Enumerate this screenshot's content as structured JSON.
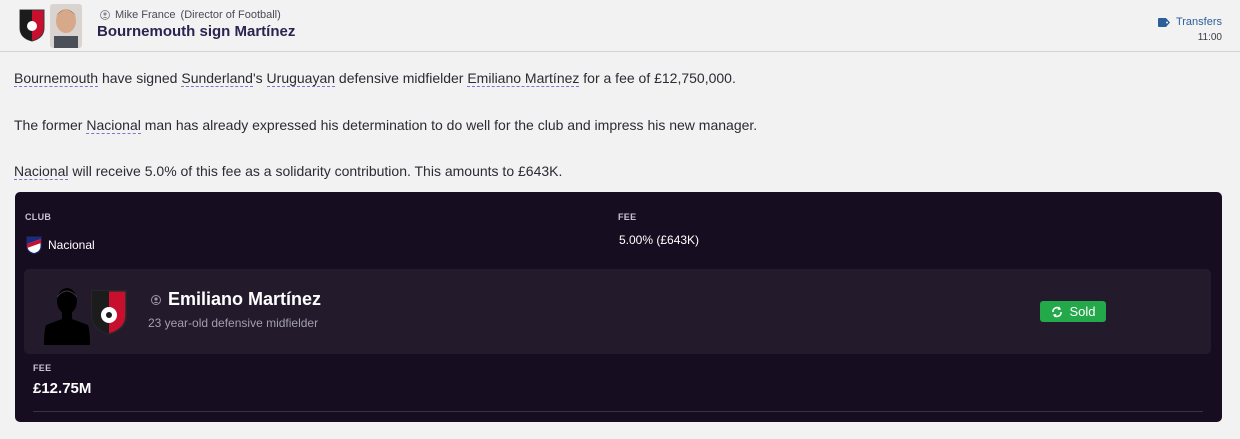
{
  "header": {
    "sender_name": "Mike France",
    "sender_role": "(Director of Football)",
    "title": "Bournemouth sign Martínez",
    "category": "Transfers",
    "time": "11:00"
  },
  "body": {
    "p1": {
      "club": "Bournemouth",
      "t1": " have signed ",
      "from_club": "Sunderland",
      "t2": "'s ",
      "nationality": "Uruguayan",
      "t3": " defensive midfielder ",
      "player": "Emiliano Martínez",
      "t4": " for a fee of £12,750,000."
    },
    "p2": {
      "t1": "The former ",
      "club": "Nacional",
      "t2": " man has already expressed his determination to do well for the club and impress his new manager."
    },
    "p3": {
      "club": "Nacional",
      "t1": " will receive 5.0% of this fee as a solidarity contribution. This amounts to £643K."
    }
  },
  "panel": {
    "club_label": "CLUB",
    "club_value": "Nacional",
    "fee_label": "FEE",
    "fee_value": "5.00% (£643K)",
    "player": {
      "name": "Emiliano Martínez",
      "description": "23 year-old defensive midfielder",
      "status": "Sold"
    },
    "bottom_fee_label": "FEE",
    "bottom_fee_value": "£12.75M"
  },
  "colors": {
    "accent": "#2a2450",
    "panel_bg": "#170d20",
    "card_bg": "#231b2c",
    "status_sold": "#23a84a",
    "link": "#2c5f99"
  }
}
